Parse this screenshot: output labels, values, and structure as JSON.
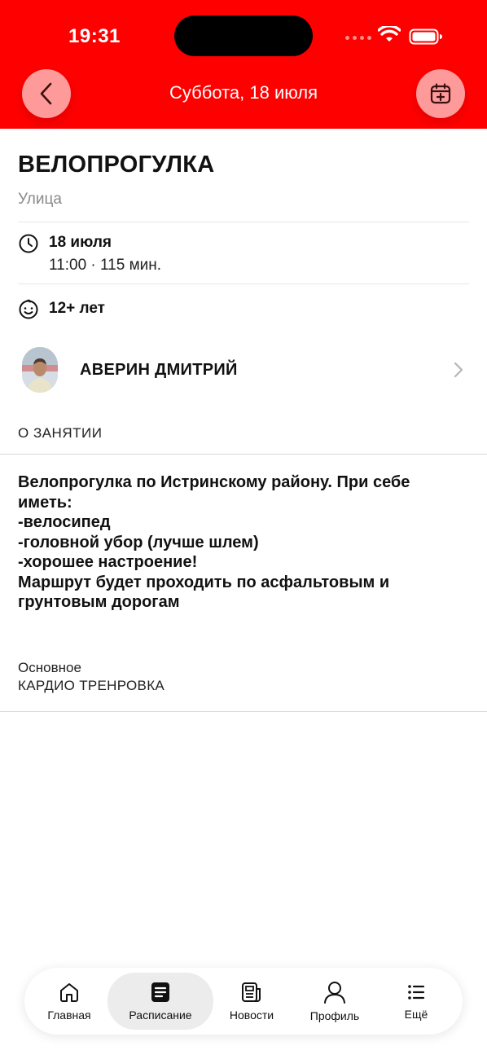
{
  "status_bar": {
    "time": "19:31"
  },
  "header": {
    "title": "Суббота, 18 июля",
    "accent_color": "#ff0000",
    "back_icon": "chevron-left-icon",
    "add_to_calendar_icon": "calendar-plus-icon"
  },
  "event": {
    "title": "ВЕЛОПРОГУЛКА",
    "location": "Улица",
    "date": "18 июля",
    "time_duration": "11:00 · 115 мин.",
    "age": "12+ лет"
  },
  "trainer": {
    "name": "АВЕРИН ДМИТРИЙ"
  },
  "about": {
    "label": "О ЗАНЯТИИ",
    "description_lines": [
      "Велопрогулка по Истринскому району. При себе",
      "иметь:",
      "-велосипед",
      "-головной убор (лучше шлем)",
      "-хорошее настроение!",
      "Маршрут будет проходить по асфальтовым и",
      "грунтовым дорогам"
    ]
  },
  "category": {
    "label": "Основное",
    "value": "КАРДИО ТРЕНРОВКА"
  },
  "tabbar": {
    "items": [
      {
        "label": "Главная",
        "icon": "home-icon"
      },
      {
        "label": "Расписание",
        "icon": "schedule-icon",
        "active": true
      },
      {
        "label": "Новости",
        "icon": "news-icon"
      },
      {
        "label": "Профиль",
        "icon": "profile-icon"
      },
      {
        "label": "Ещё",
        "icon": "more-list-icon"
      }
    ]
  }
}
